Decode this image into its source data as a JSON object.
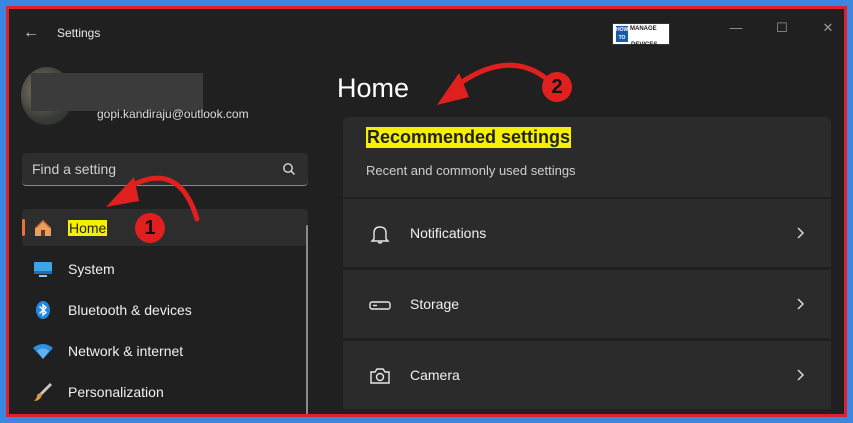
{
  "window": {
    "title": "Settings",
    "back_glyph": "←",
    "minimize_glyph": "—",
    "maximize_glyph": "☐",
    "close_glyph": "✕"
  },
  "logo": {
    "line1": "HOW TO",
    "line2": "MANAGE",
    "line3": "DEVICES"
  },
  "account": {
    "email": "gopi.kandiraju@outlook.com"
  },
  "search": {
    "placeholder": "Find a setting",
    "icon": "search-icon"
  },
  "nav": {
    "items": [
      {
        "label": "Home",
        "icon": "home-icon",
        "active": true
      },
      {
        "label": "System",
        "icon": "monitor-icon"
      },
      {
        "label": "Bluetooth & devices",
        "icon": "bluetooth-icon"
      },
      {
        "label": "Network & internet",
        "icon": "wifi-icon"
      },
      {
        "label": "Personalization",
        "icon": "brush-icon"
      }
    ]
  },
  "main": {
    "title": "Home",
    "recommended": {
      "title": "Recommended settings",
      "subtitle": "Recent and commonly used settings",
      "rows": [
        {
          "label": "Notifications",
          "icon": "bell-icon"
        },
        {
          "label": "Storage",
          "icon": "storage-icon"
        },
        {
          "label": "Camera",
          "icon": "camera-icon"
        }
      ]
    }
  },
  "callouts": [
    "1",
    "2"
  ],
  "colors": {
    "highlight": "#f4f000",
    "accent": "#e8703a",
    "annotation": "#e01f1f",
    "frame": "#e0202a"
  }
}
